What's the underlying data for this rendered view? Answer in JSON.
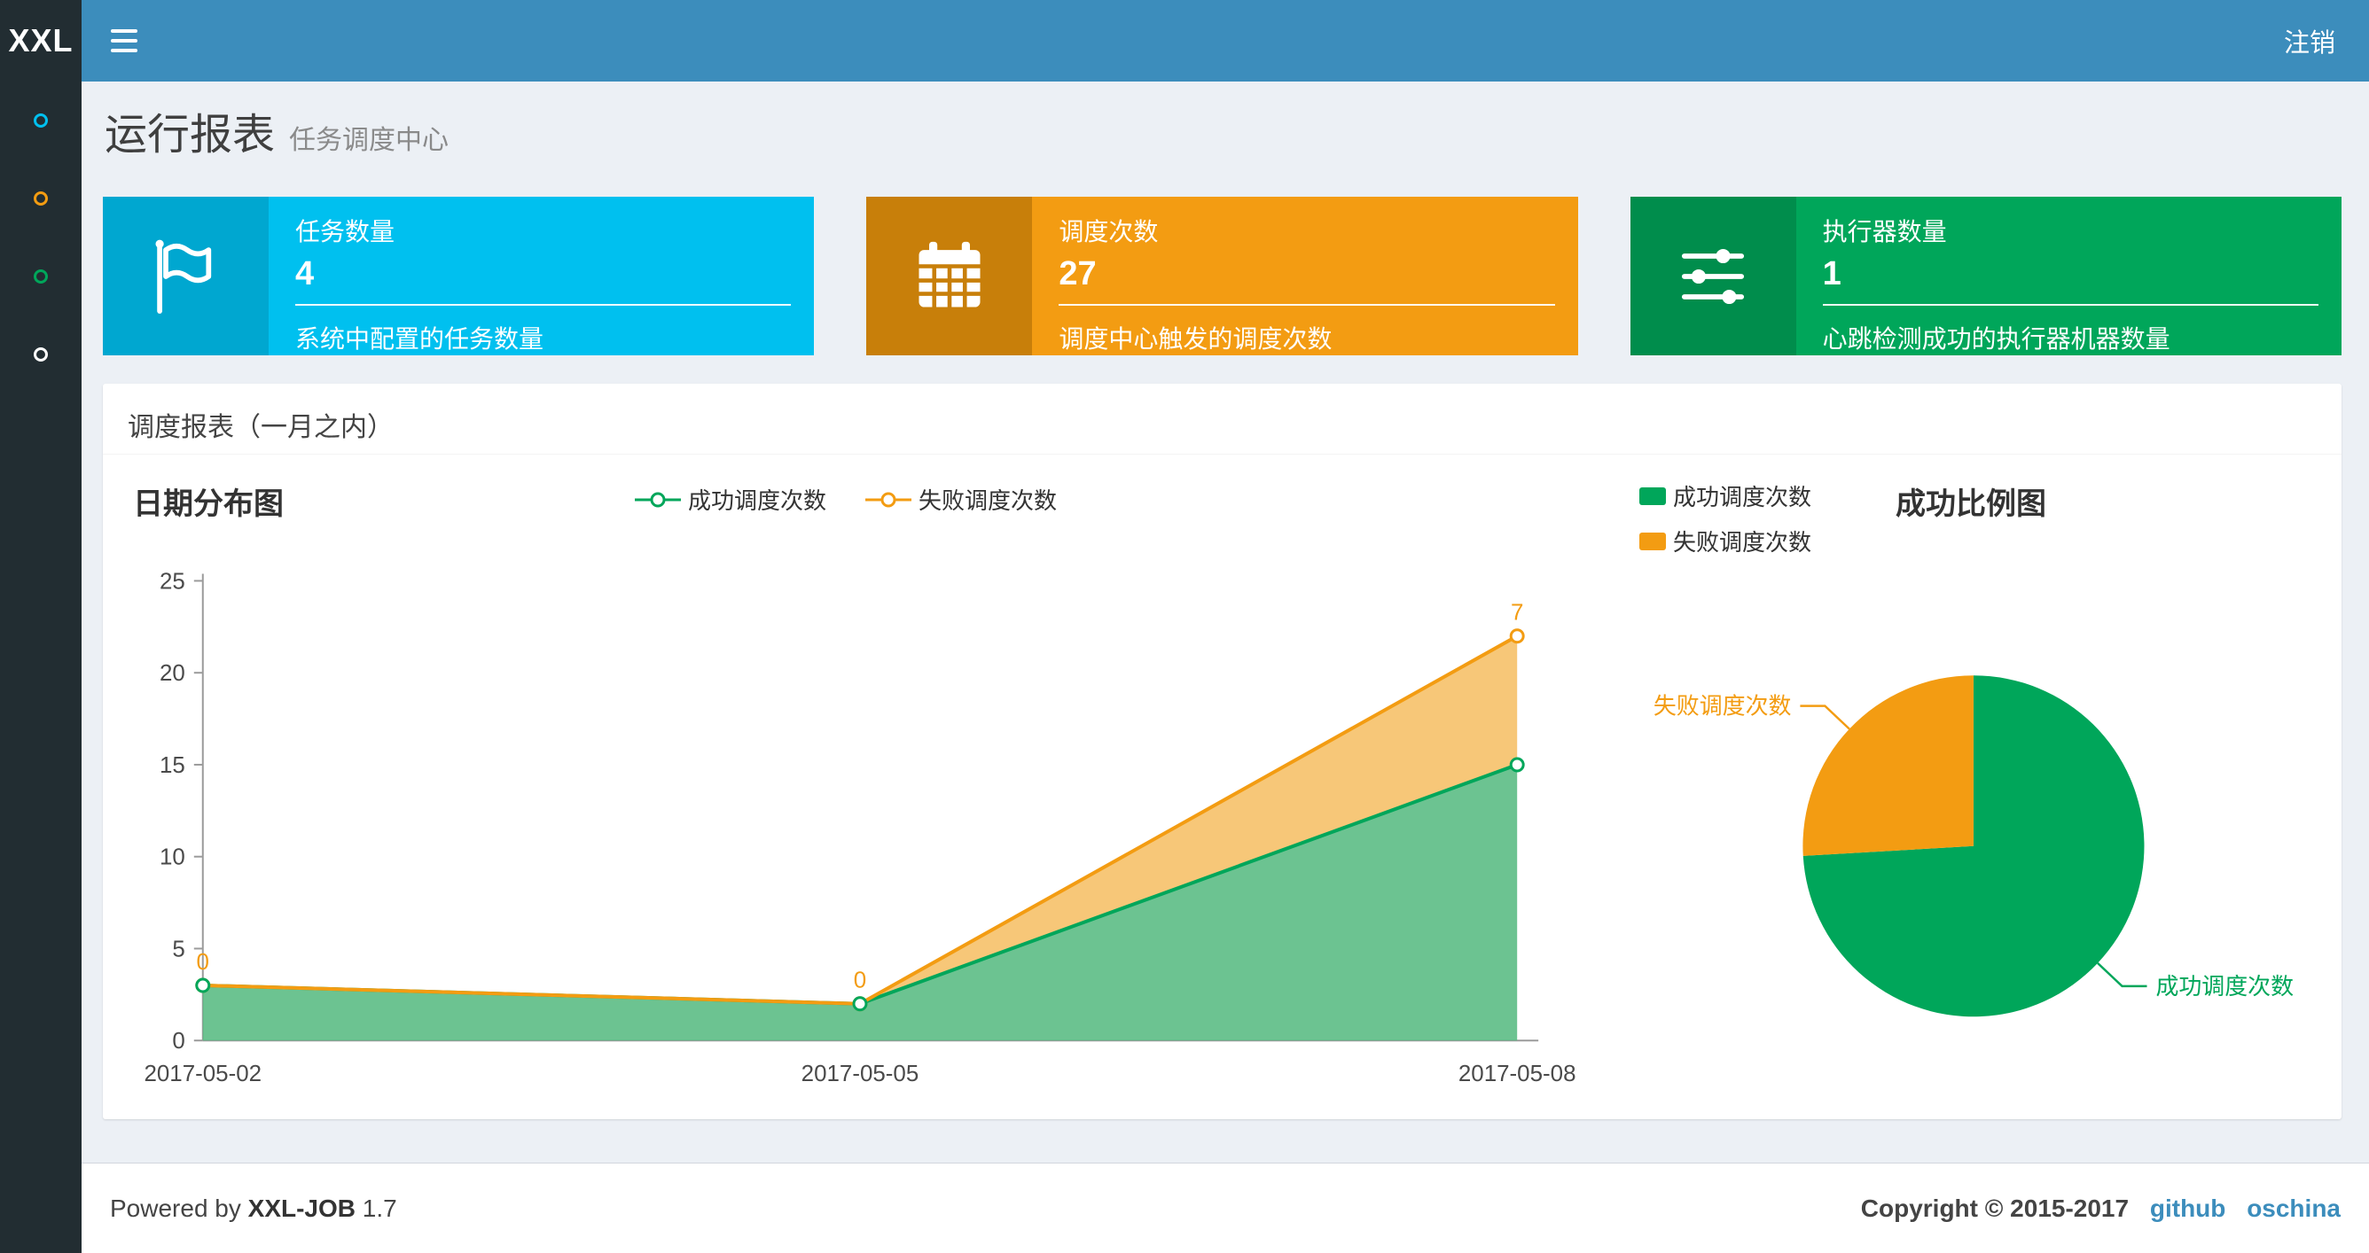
{
  "navbar": {
    "logo": "XXL",
    "logout_label": "注销"
  },
  "sidebar": {
    "items": [
      {
        "color": "#00c0ef"
      },
      {
        "color": "#f39c12"
      },
      {
        "color": "#00a65a"
      },
      {
        "color": "#ffffff"
      }
    ]
  },
  "page_header": {
    "title": "运行报表",
    "subtitle": "任务调度中心"
  },
  "info_boxes": [
    {
      "title": "任务数量",
      "value": "4",
      "desc": "系统中配置的任务数量",
      "bg": "#00c0ef",
      "icon_bg": "#00a7d0",
      "icon": "flag-icon"
    },
    {
      "title": "调度次数",
      "value": "27",
      "desc": "调度中心触发的调度次数",
      "bg": "#f39c12",
      "icon_bg": "#c87f0a",
      "icon": "calendar-icon"
    },
    {
      "title": "执行器数量",
      "value": "1",
      "desc": "心跳检测成功的执行器机器数量",
      "bg": "#00a65a",
      "icon_bg": "#008d4c",
      "icon": "sliders-icon"
    }
  ],
  "panel": {
    "title": "调度报表（一月之内）"
  },
  "chart_data": [
    {
      "type": "area",
      "title": "日期分布图",
      "stacked": true,
      "x": [
        "2017-05-02",
        "2017-05-05",
        "2017-05-08"
      ],
      "series": [
        {
          "name": "成功调度次数",
          "color": "#00a65a",
          "fill": "#5cbd85",
          "values": [
            3,
            2,
            15
          ]
        },
        {
          "name": "失败调度次数",
          "color": "#f39c12",
          "fill": "#f6c169",
          "values": [
            0,
            0,
            7
          ],
          "point_labels": [
            "0",
            "0",
            "7"
          ]
        }
      ],
      "ylim": [
        0,
        25
      ],
      "yticks": [
        0,
        5,
        10,
        15,
        20,
        25
      ],
      "legend_position": "top",
      "grid": false
    },
    {
      "type": "pie",
      "title": "成功比例图",
      "slices": [
        {
          "name": "成功调度次数",
          "value": 20,
          "color": "#00a65a"
        },
        {
          "name": "失败调度次数",
          "value": 7,
          "color": "#f39c12"
        }
      ],
      "legend_position": "top-left"
    }
  ],
  "footer": {
    "powered_by": "Powered by",
    "app_name": "XXL-JOB",
    "version": "1.7",
    "copyright": "Copyright © 2015-2017",
    "links": [
      "github",
      "oschina"
    ]
  }
}
